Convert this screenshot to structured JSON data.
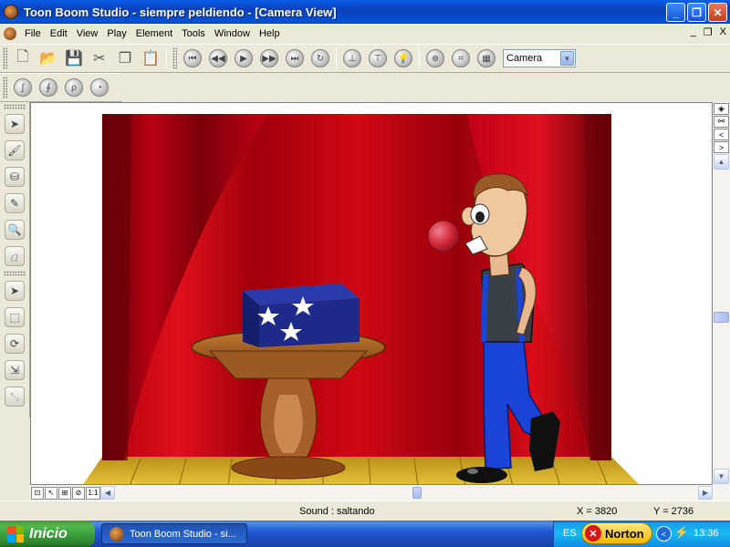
{
  "window": {
    "title": "Toon Boom Studio - siempre peldiendo - [Camera View]",
    "minimize": "_",
    "restore": "❐",
    "close": "✕"
  },
  "menu": {
    "items": [
      "File",
      "Edit",
      "View",
      "Play",
      "Element",
      "Tools",
      "Window",
      "Help"
    ],
    "mdi_minimize": "_",
    "mdi_restore": "❐",
    "mdi_close": "X"
  },
  "toolbar": {
    "view_select": "Camera",
    "buttons": [
      "new",
      "open",
      "save",
      "cut",
      "copy",
      "paste",
      "first-frame",
      "previous-frame",
      "play",
      "next-frame",
      "last-frame",
      "loop",
      "onion-skin-previous",
      "onion-skin-next",
      "light-table",
      "grid",
      "field-chart",
      "safe-area"
    ],
    "drawing_tools": [
      "pencil-tool",
      "brush-tool",
      "ink-tool",
      "paint-tool"
    ]
  },
  "palette": {
    "tools": [
      "select-tool",
      "brush-tool",
      "paint-bucket-tool",
      "brush-alt-tool",
      "zoom-tool",
      "text-tool",
      "transform-select-tool",
      "marquee-tool",
      "rotate-tool",
      "scale-tool",
      "motion-tool"
    ]
  },
  "scene": {
    "description_colors": {
      "curtain": "#a8000a",
      "curtain_dark": "#5a0006",
      "floor": "#d8b428",
      "box": "#1e2a8a",
      "table": "#8a4a18",
      "bubble": "#d83040",
      "pants": "#1a44d8"
    }
  },
  "bottom_strip": {
    "tool_labels": [
      "⊡",
      "↖",
      "⊞",
      "⊘",
      "1:1"
    ]
  },
  "status": {
    "sound": "Sound : saltando",
    "x": "X = 3820",
    "y": "Y = 2736"
  },
  "taskbar": {
    "start": "Inicio",
    "task": "Toon Boom Studio - si...",
    "lang": "ES",
    "norton": "Norton",
    "clock": "13:36"
  }
}
